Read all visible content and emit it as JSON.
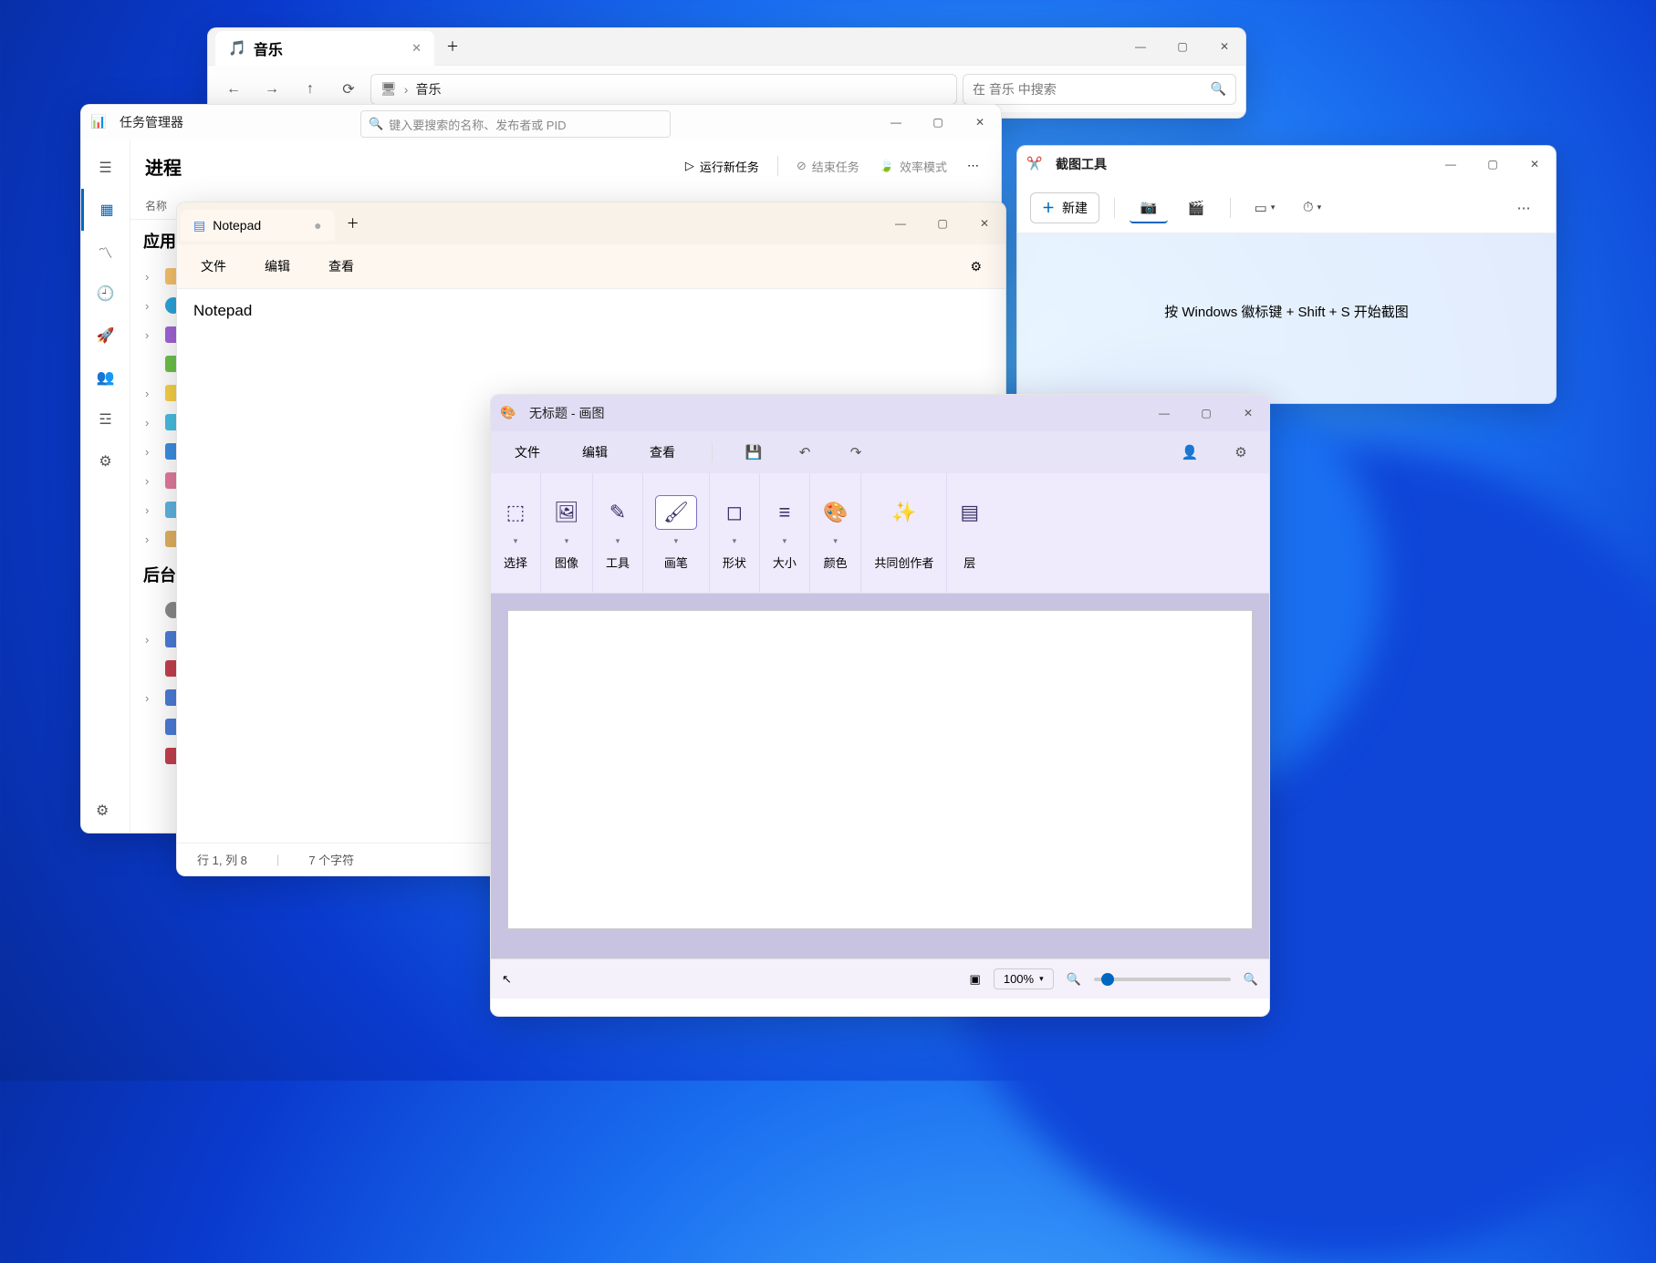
{
  "music": {
    "tab_title": "音乐",
    "breadcrumb": "音乐",
    "search_placeholder": "在 音乐 中搜索"
  },
  "taskmgr": {
    "title": "任务管理器",
    "search_placeholder": "键入要搜索的名称、发布者或 PID",
    "section": "进程",
    "run_new": "运行新任务",
    "end_task": "结束任务",
    "eff_mode": "效率模式",
    "col_name": "名称",
    "group_apps": "应用",
    "group_bg": "后台"
  },
  "notepad": {
    "tab_title": "Notepad",
    "menu": {
      "file": "文件",
      "edit": "编辑",
      "view": "查看"
    },
    "content": "Notepad",
    "status_pos": "行 1, 列 8",
    "status_chars": "7 个字符"
  },
  "snip": {
    "title": "截图工具",
    "new": "新建",
    "hint": "按 Windows 徽标键 + Shift + S 开始截图"
  },
  "paint": {
    "title": "无标题 - 画图",
    "menu": {
      "file": "文件",
      "edit": "编辑",
      "view": "查看"
    },
    "groups": {
      "select": "选择",
      "image": "图像",
      "tools": "工具",
      "brush": "画笔",
      "shapes": "形状",
      "size": "大小",
      "colors": "颜色",
      "cocreate": "共同创作者",
      "layers": "层"
    },
    "zoom": "100%"
  }
}
